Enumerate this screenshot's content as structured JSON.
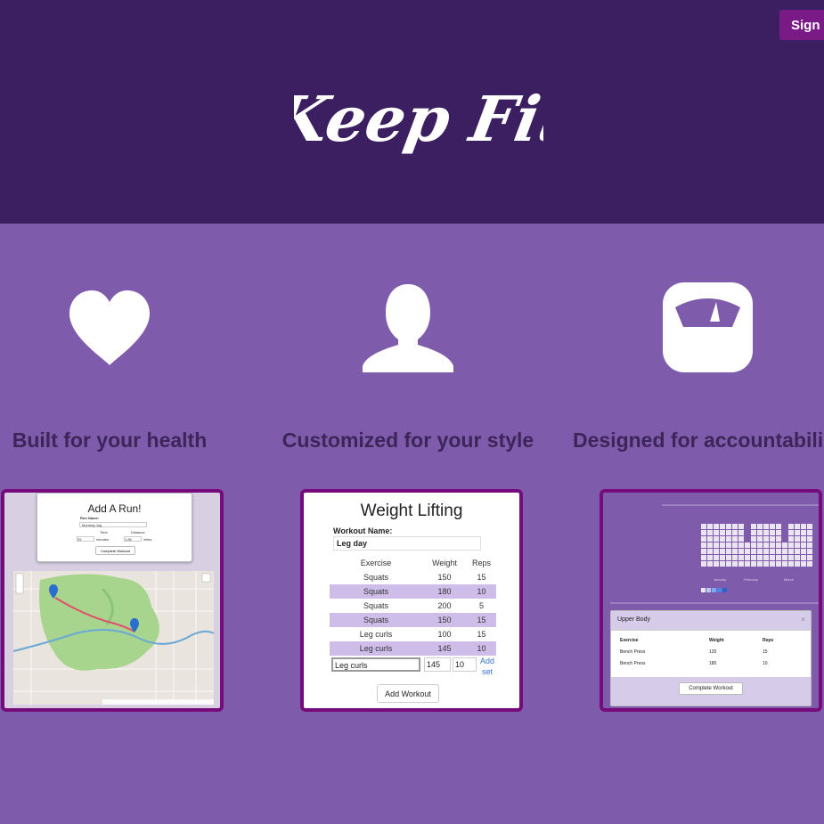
{
  "header": {
    "sign_in_label": "Sign i",
    "logo_text": "Keep Fit"
  },
  "features": [
    {
      "icon": "heart-icon",
      "title": "Built for your health"
    },
    {
      "icon": "user-icon",
      "title": "Customized for your style"
    },
    {
      "icon": "scale-icon",
      "title": "Designed for accountabili"
    }
  ],
  "run_card": {
    "title": "Add A Run!",
    "run_name_label": "Run Name:",
    "run_name_value": "Morning Jog",
    "time_label": "Time",
    "distance_label": "Distance",
    "time_value": "25",
    "time_unit": "minutes",
    "distance_value": "1.85",
    "distance_unit": "miles",
    "button": "Complete Workout"
  },
  "weight_lifting": {
    "title": "Weight Lifting",
    "workout_name_label": "Workout Name:",
    "workout_name_value": "Leg day",
    "columns": [
      "Exercise",
      "Weight",
      "Reps"
    ],
    "rows": [
      [
        "Squats",
        "150",
        "15"
      ],
      [
        "Squats",
        "180",
        "10"
      ],
      [
        "Squats",
        "200",
        "5"
      ],
      [
        "Squats",
        "150",
        "15"
      ],
      [
        "Leg curls",
        "100",
        "15"
      ],
      [
        "Leg curls",
        "145",
        "10"
      ]
    ],
    "input_exercise": "Leg curls",
    "input_weight": "145",
    "input_reps": "10",
    "add_set_label": "Add set",
    "add_workout_label": "Add Workout"
  },
  "upper_body": {
    "title": "Upper Body",
    "close": "×",
    "columns": [
      "Exercise",
      "Weight",
      "Reps"
    ],
    "rows": [
      [
        "Bench Press",
        "120",
        "15"
      ],
      [
        "Bench Press",
        "180",
        "10"
      ]
    ],
    "button": "Complete Workout",
    "calendar_months": [
      "January",
      "February",
      "March"
    ]
  },
  "colors": {
    "header_bg": "#3b1f61",
    "page_bg": "#7f5cab",
    "accent": "#760c7c",
    "heading_text": "#3d2459"
  }
}
